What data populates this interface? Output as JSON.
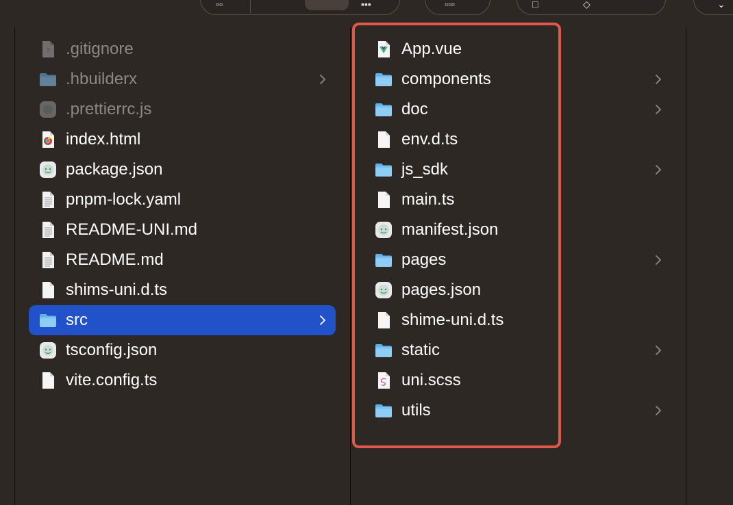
{
  "colors": {
    "background": "#2e2825",
    "selection": "#2252c9",
    "highlight_border": "#e0594a",
    "folder_light": "#8fcdf5",
    "folder_dark": "#5fb3ec",
    "dim_text": "#8e8883"
  },
  "left_column": {
    "items": [
      {
        "label": ".gitignore",
        "icon": "hidden-file-icon"
      },
      {
        "label": ".hbuilderx",
        "icon": "folder-icon"
      },
      {
        "label": ".prettierrc.js",
        "icon": "script-file-icon"
      },
      {
        "label": "index.html",
        "icon": "html-file-icon"
      },
      {
        "label": "package.json",
        "icon": "json-file-icon"
      },
      {
        "label": "pnpm-lock.yaml",
        "icon": "text-document-icon"
      },
      {
        "label": "README-UNI.md",
        "icon": "text-document-icon"
      },
      {
        "label": "README.md",
        "icon": "text-document-icon"
      },
      {
        "label": "shims-uni.d.ts",
        "icon": "file-icon"
      },
      {
        "label": "src",
        "icon": "folder-icon"
      },
      {
        "label": "tsconfig.json",
        "icon": "json-file-icon"
      },
      {
        "label": "vite.config.ts",
        "icon": "file-icon"
      }
    ]
  },
  "middle_column": {
    "items": [
      {
        "label": "App.vue",
        "icon": "vue-file-icon"
      },
      {
        "label": "components",
        "icon": "folder-icon"
      },
      {
        "label": "doc",
        "icon": "folder-icon"
      },
      {
        "label": "env.d.ts",
        "icon": "file-icon"
      },
      {
        "label": "js_sdk",
        "icon": "folder-icon"
      },
      {
        "label": "main.ts",
        "icon": "file-icon"
      },
      {
        "label": "manifest.json",
        "icon": "json-file-icon"
      },
      {
        "label": "pages",
        "icon": "folder-icon"
      },
      {
        "label": "pages.json",
        "icon": "json-file-icon"
      },
      {
        "label": "shime-uni.d.ts",
        "icon": "file-icon"
      },
      {
        "label": "static",
        "icon": "folder-icon"
      },
      {
        "label": "uni.scss",
        "icon": "sass-file-icon"
      },
      {
        "label": "utils",
        "icon": "folder-icon"
      }
    ]
  }
}
